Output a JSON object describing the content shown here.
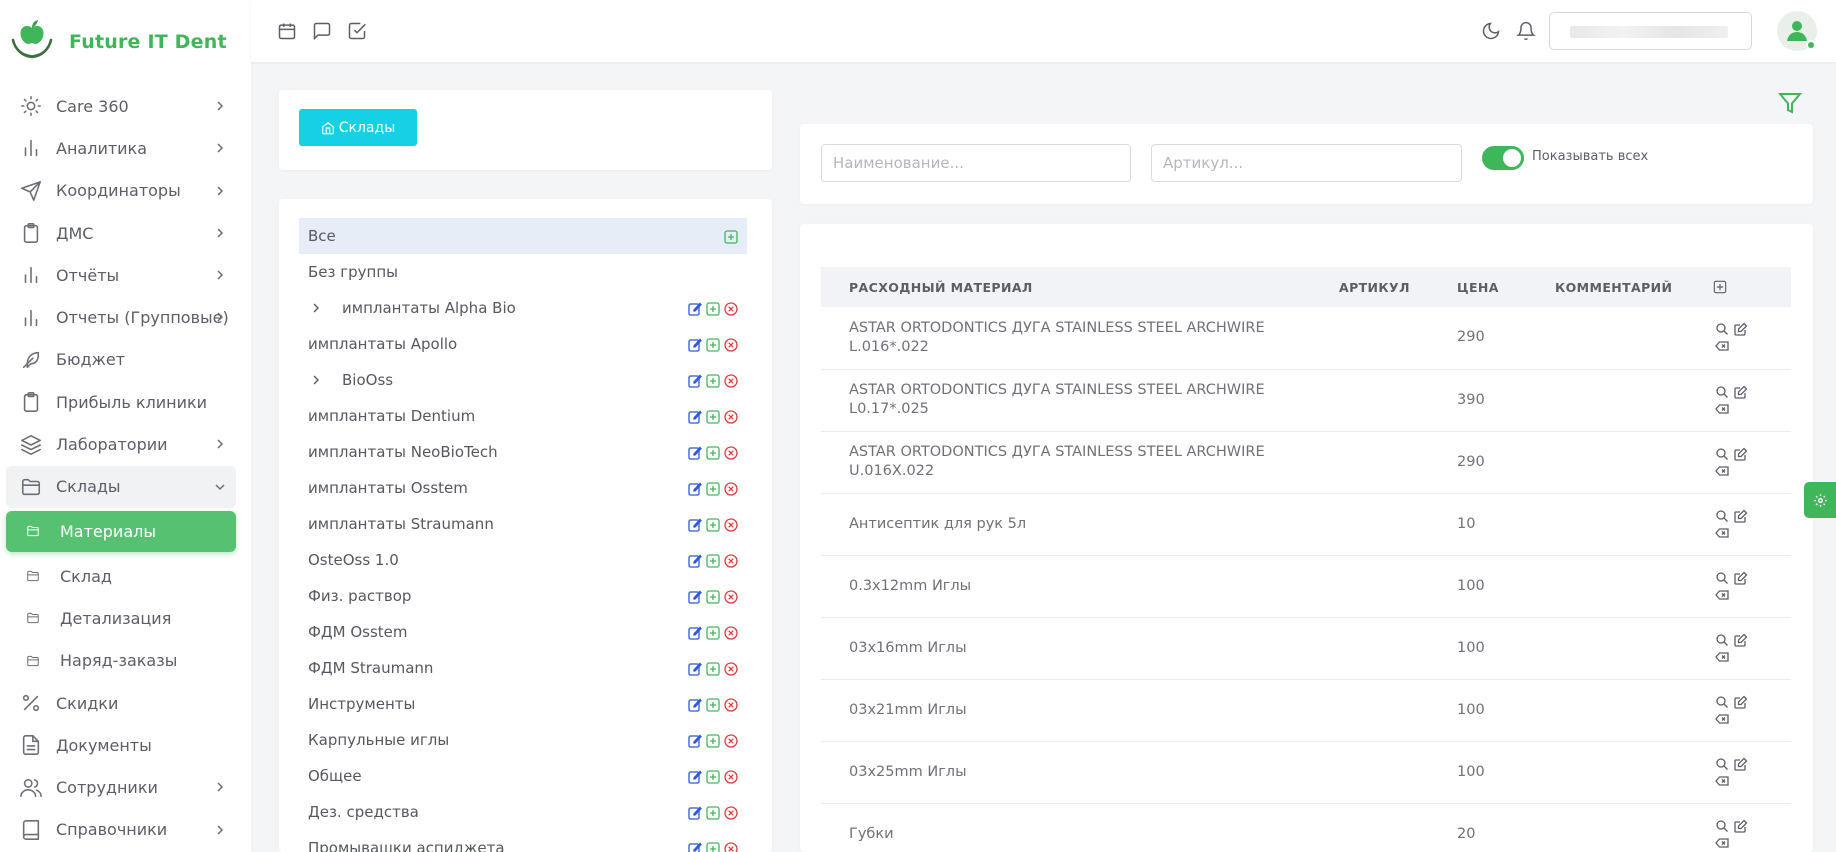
{
  "app": {
    "title": "Future IT Dent"
  },
  "colors": {
    "accent": "#3fb65a",
    "primary_button": "#16d0e6",
    "danger": "#e03b3b",
    "edit": "#2b57d9"
  },
  "sidebar": {
    "items": [
      {
        "label": "Care 360",
        "icon": "sun-icon",
        "chevron": true
      },
      {
        "label": "Аналитика",
        "icon": "bar-chart-icon",
        "chevron": true
      },
      {
        "label": "Координаторы",
        "icon": "send-icon",
        "chevron": true
      },
      {
        "label": "ДМС",
        "icon": "clipboard-icon",
        "chevron": true
      },
      {
        "label": "Отчёты",
        "icon": "bar-chart-icon",
        "chevron": true
      },
      {
        "label": "Отчеты (Групповые)",
        "icon": "bar-chart-icon",
        "chevron": true
      },
      {
        "label": "Бюджет",
        "icon": "feather-icon",
        "chevron": false
      },
      {
        "label": "Прибыль клиники",
        "icon": "clipboard-icon",
        "chevron": false
      },
      {
        "label": "Лаборатории",
        "icon": "layers-icon",
        "chevron": true
      },
      {
        "label": "Склады",
        "icon": "folder-icon",
        "chevron": true,
        "open": true
      },
      {
        "label": "Материалы",
        "icon": "folder-small-icon",
        "sub": true,
        "active": true
      },
      {
        "label": "Склад",
        "icon": "folder-small-icon",
        "sub": true
      },
      {
        "label": "Детализация",
        "icon": "folder-small-icon",
        "sub": true
      },
      {
        "label": "Наряд-заказы",
        "icon": "folder-small-icon",
        "sub": true
      },
      {
        "label": "Скидки",
        "icon": "percent-icon",
        "chevron": false
      },
      {
        "label": "Документы",
        "icon": "file-icon",
        "chevron": false
      },
      {
        "label": "Сотрудники",
        "icon": "users-icon",
        "chevron": true
      },
      {
        "label": "Справочники",
        "icon": "book-icon",
        "chevron": true
      }
    ]
  },
  "left_panel": {
    "button_label": "Склады",
    "groups": [
      {
        "label": "Все",
        "selected": true,
        "add_only": true
      },
      {
        "label": "Без группы",
        "no_actions": true
      },
      {
        "label": "имплантаты Alpha Bio",
        "expandable": true
      },
      {
        "label": "имплантаты Apollo"
      },
      {
        "label": "BioOss",
        "expandable": true
      },
      {
        "label": "имплантаты Dentium"
      },
      {
        "label": "имплантаты NeoBioTech"
      },
      {
        "label": "имплантаты Osstem"
      },
      {
        "label": "имплантаты Straumann"
      },
      {
        "label": "OsteOss 1.0"
      },
      {
        "label": "Физ. раствор"
      },
      {
        "label": "ФДМ Osstem"
      },
      {
        "label": "ФДМ Straumann"
      },
      {
        "label": "Инструменты"
      },
      {
        "label": "Карпульные иглы"
      },
      {
        "label": "Общее"
      },
      {
        "label": "Дез. средства"
      },
      {
        "label": "Промывашки аспиджета"
      }
    ]
  },
  "filters": {
    "name_placeholder": "Наименование...",
    "article_placeholder": "Артикул...",
    "show_all_label": "Показывать всех",
    "show_all_on": true
  },
  "table": {
    "headers": [
      "РАСХОДНЫЙ МАТЕРИАЛ",
      "АРТИКУЛ",
      "ЦЕНА",
      "КОММЕНТАРИЙ"
    ],
    "rows": [
      {
        "name": "ASTAR ORTODONTICS ДУГА STAINLESS STEEL ARCHWIRE L.016*.022",
        "article": "",
        "price": "290",
        "comment": ""
      },
      {
        "name": "ASTAR ORTODONTICS ДУГА STAINLESS STEEL ARCHWIRE L0.17*.025",
        "article": "",
        "price": "390",
        "comment": ""
      },
      {
        "name": "ASTAR ORTODONTICS ДУГА STAINLESS STEEL ARCHWIRE U.016X.022",
        "article": "",
        "price": "290",
        "comment": ""
      },
      {
        "name": "Антисептик для рук 5л",
        "article": "",
        "price": "10",
        "comment": ""
      },
      {
        "name": "0.3x12mm Иглы",
        "article": "",
        "price": "100",
        "comment": ""
      },
      {
        "name": "03x16mm Иглы",
        "article": "",
        "price": "100",
        "comment": ""
      },
      {
        "name": "03x21mm Иглы",
        "article": "",
        "price": "100",
        "comment": ""
      },
      {
        "name": "03x25mm Иглы",
        "article": "",
        "price": "100",
        "comment": ""
      },
      {
        "name": "Губки",
        "article": "",
        "price": "20",
        "comment": ""
      }
    ]
  }
}
